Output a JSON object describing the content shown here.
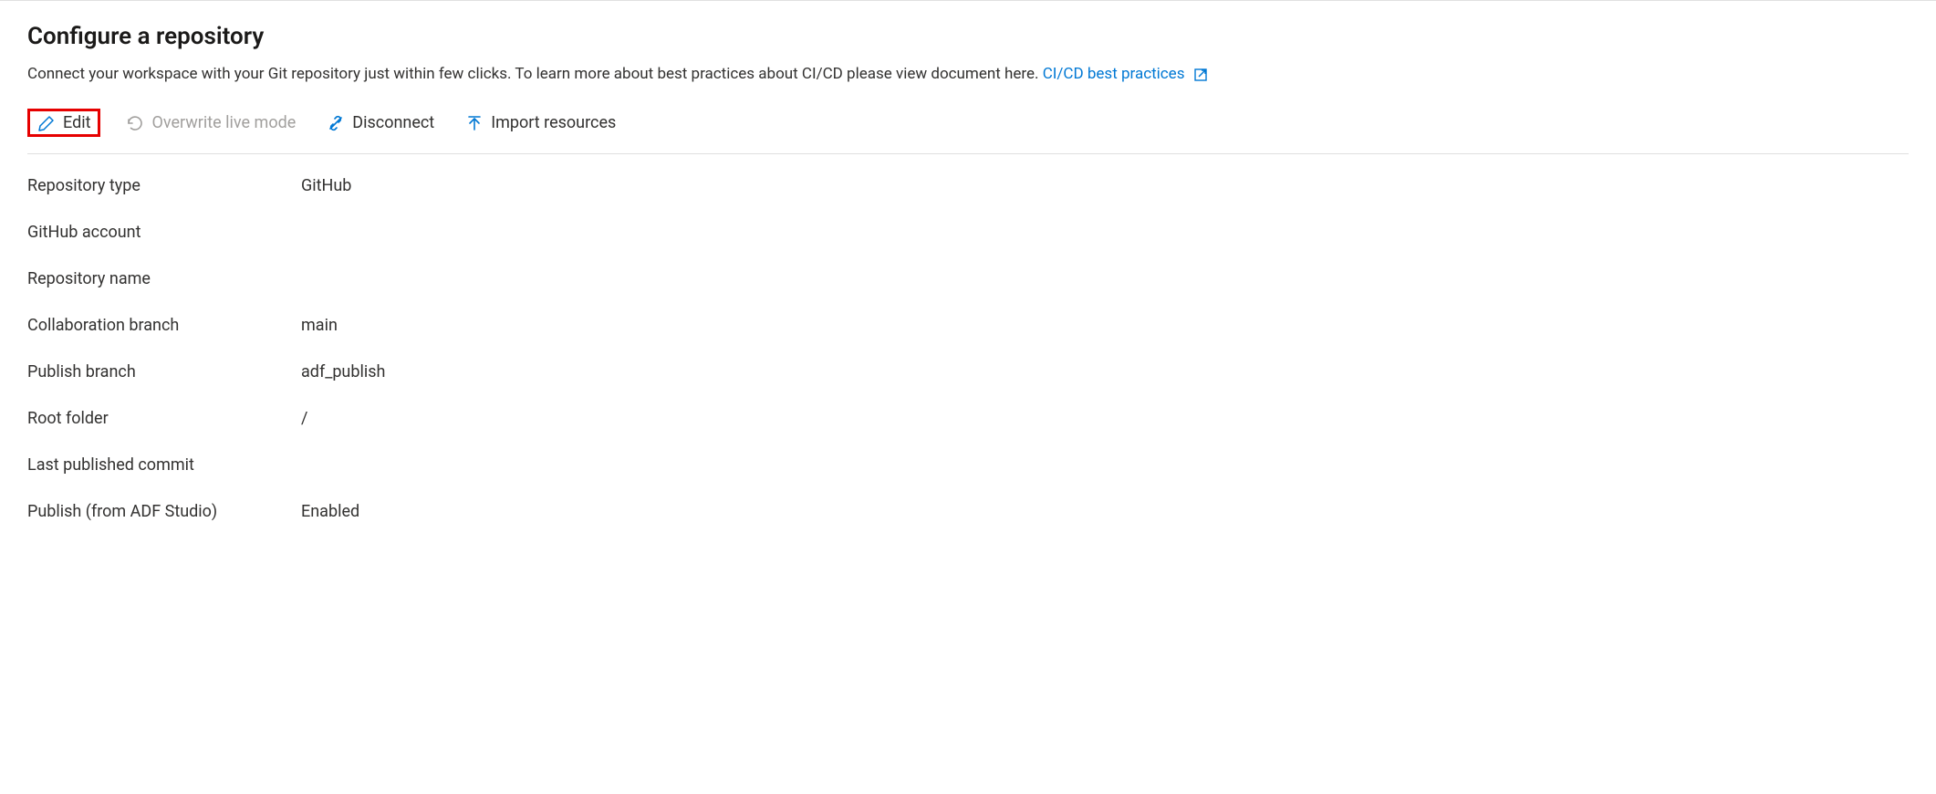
{
  "header": {
    "title": "Configure a repository",
    "description": "Connect your workspace with your Git repository just within few clicks. To learn more about best practices about CI/CD please view document here.",
    "link_text": "CI/CD best practices"
  },
  "toolbar": {
    "edit": "Edit",
    "overwrite": "Overwrite live mode",
    "disconnect": "Disconnect",
    "import": "Import resources"
  },
  "fields": [
    {
      "label": "Repository type",
      "value": "GitHub"
    },
    {
      "label": "GitHub account",
      "value": ""
    },
    {
      "label": "Repository name",
      "value": ""
    },
    {
      "label": "Collaboration branch",
      "value": "main"
    },
    {
      "label": "Publish branch",
      "value": "adf_publish"
    },
    {
      "label": "Root folder",
      "value": "/"
    },
    {
      "label": "Last published commit",
      "value": ""
    },
    {
      "label": "Publish (from ADF Studio)",
      "value": "Enabled"
    }
  ]
}
